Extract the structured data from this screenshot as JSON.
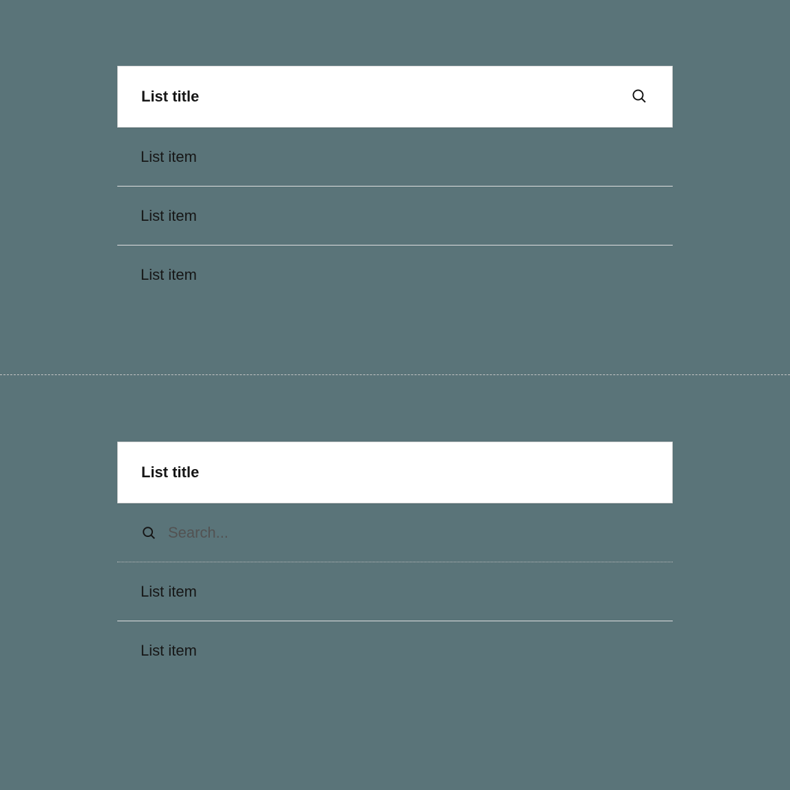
{
  "panel_top": {
    "title": "List title",
    "items": [
      {
        "label": "List item"
      },
      {
        "label": "List item"
      },
      {
        "label": "List item"
      }
    ]
  },
  "panel_bottom": {
    "title": "List title",
    "search_placeholder": "Search...",
    "items": [
      {
        "label": "List item"
      },
      {
        "label": "List item"
      }
    ]
  }
}
